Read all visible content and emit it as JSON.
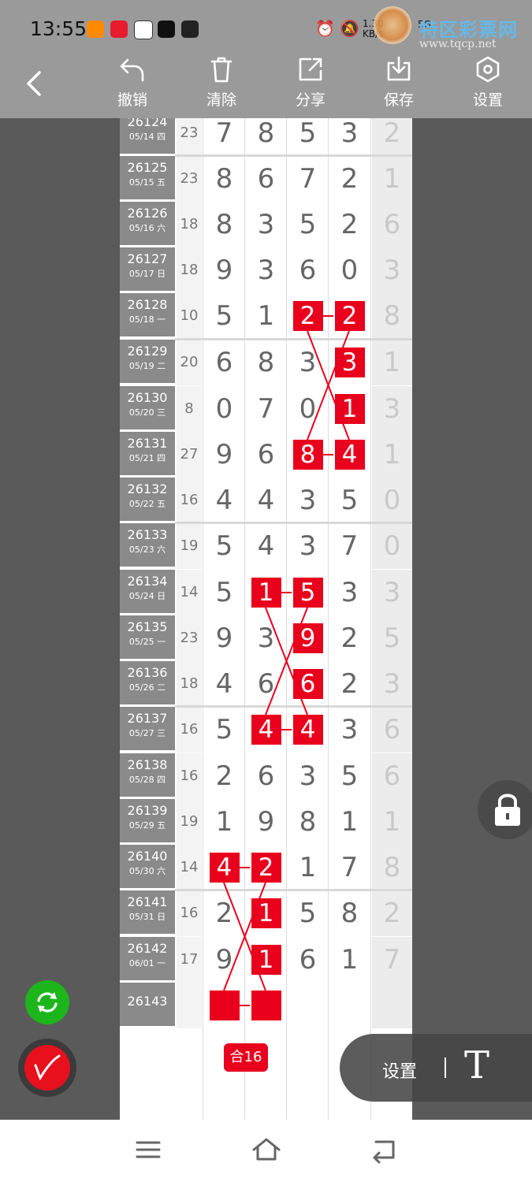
{
  "status": {
    "time": "13:55",
    "net_speed": "1.30 KB/s",
    "signal": "5G"
  },
  "watermark": {
    "site": "特区彩票网",
    "url": "www.tqcp.net"
  },
  "toolbar": {
    "undo": "撤销",
    "clear": "清除",
    "share": "分享",
    "save": "保存",
    "settings": "设置"
  },
  "rows": [
    {
      "id": "26124",
      "date": "05/14 四",
      "sum": "23",
      "d": [
        "7",
        "8",
        "5",
        "3"
      ],
      "hl": [
        0,
        0,
        0,
        0
      ],
      "extra": "2"
    },
    {
      "id": "26125",
      "date": "05/15 五",
      "sum": "23",
      "d": [
        "8",
        "6",
        "7",
        "2"
      ],
      "hl": [
        0,
        0,
        0,
        0
      ],
      "extra": "1"
    },
    {
      "id": "26126",
      "date": "05/16 六",
      "sum": "18",
      "d": [
        "8",
        "3",
        "5",
        "2"
      ],
      "hl": [
        0,
        0,
        0,
        0
      ],
      "extra": "6"
    },
    {
      "id": "26127",
      "date": "05/17 日",
      "sum": "18",
      "d": [
        "9",
        "3",
        "6",
        "0"
      ],
      "hl": [
        0,
        0,
        0,
        0
      ],
      "extra": "3"
    },
    {
      "id": "26128",
      "date": "05/18 一",
      "sum": "10",
      "d": [
        "5",
        "1",
        "2",
        "2"
      ],
      "hl": [
        0,
        0,
        1,
        1
      ],
      "extra": "8"
    },
    {
      "id": "26129",
      "date": "05/19 二",
      "sum": "20",
      "d": [
        "6",
        "8",
        "3",
        "3"
      ],
      "hl": [
        0,
        0,
        0,
        1
      ],
      "extra": "1"
    },
    {
      "id": "26130",
      "date": "05/20 三",
      "sum": "8",
      "d": [
        "0",
        "7",
        "0",
        "1"
      ],
      "hl": [
        0,
        0,
        0,
        1
      ],
      "extra": "3"
    },
    {
      "id": "26131",
      "date": "05/21 四",
      "sum": "27",
      "d": [
        "9",
        "6",
        "8",
        "4"
      ],
      "hl": [
        0,
        0,
        1,
        1
      ],
      "extra": "1"
    },
    {
      "id": "26132",
      "date": "05/22 五",
      "sum": "16",
      "d": [
        "4",
        "4",
        "3",
        "5"
      ],
      "hl": [
        0,
        0,
        0,
        0
      ],
      "extra": "0"
    },
    {
      "id": "26133",
      "date": "05/23 六",
      "sum": "19",
      "d": [
        "5",
        "4",
        "3",
        "7"
      ],
      "hl": [
        0,
        0,
        0,
        0
      ],
      "extra": "0"
    },
    {
      "id": "26134",
      "date": "05/24 日",
      "sum": "14",
      "d": [
        "5",
        "1",
        "5",
        "3"
      ],
      "hl": [
        0,
        1,
        1,
        0
      ],
      "extra": "3"
    },
    {
      "id": "26135",
      "date": "05/25 一",
      "sum": "23",
      "d": [
        "9",
        "3",
        "9",
        "2"
      ],
      "hl": [
        0,
        0,
        1,
        0
      ],
      "extra": "5"
    },
    {
      "id": "26136",
      "date": "05/26 二",
      "sum": "18",
      "d": [
        "4",
        "6",
        "6",
        "2"
      ],
      "hl": [
        0,
        0,
        1,
        0
      ],
      "extra": "3"
    },
    {
      "id": "26137",
      "date": "05/27 三",
      "sum": "16",
      "d": [
        "5",
        "4",
        "4",
        "3"
      ],
      "hl": [
        0,
        1,
        1,
        0
      ],
      "extra": "6"
    },
    {
      "id": "26138",
      "date": "05/28 四",
      "sum": "16",
      "d": [
        "2",
        "6",
        "3",
        "5"
      ],
      "hl": [
        0,
        0,
        0,
        0
      ],
      "extra": "6"
    },
    {
      "id": "26139",
      "date": "05/29 五",
      "sum": "19",
      "d": [
        "1",
        "9",
        "8",
        "1"
      ],
      "hl": [
        0,
        0,
        0,
        0
      ],
      "extra": "1"
    },
    {
      "id": "26140",
      "date": "05/30 六",
      "sum": "14",
      "d": [
        "4",
        "2",
        "1",
        "7"
      ],
      "hl": [
        1,
        1,
        0,
        0
      ],
      "extra": "8"
    },
    {
      "id": "26141",
      "date": "05/31 日",
      "sum": "16",
      "d": [
        "2",
        "1",
        "5",
        "8"
      ],
      "hl": [
        0,
        1,
        0,
        0
      ],
      "extra": "2"
    },
    {
      "id": "26142",
      "date": "06/01 一",
      "sum": "17",
      "d": [
        "9",
        "1",
        "6",
        "1"
      ],
      "hl": [
        0,
        1,
        0,
        0
      ],
      "extra": "7"
    },
    {
      "id": "26143",
      "date": "",
      "sum": "",
      "d": [
        "",
        "",
        "",
        ""
      ],
      "hl": [
        1,
        1,
        0,
        0
      ],
      "extra": ""
    }
  ],
  "sum_badge": "合16",
  "settings_pill": {
    "label": "设置",
    "text_icon": "T"
  },
  "icons": {
    "back": "chevron-left-icon",
    "lock": "lock-icon",
    "refresh": "refresh-icon",
    "pen": "pen-icon",
    "menu": "menu-icon",
    "home": "home-icon",
    "return": "back-nav-icon"
  },
  "colors": {
    "accent": "#e8001c",
    "refresh": "#1cb51c",
    "toolbar": "#9a9a9a"
  }
}
